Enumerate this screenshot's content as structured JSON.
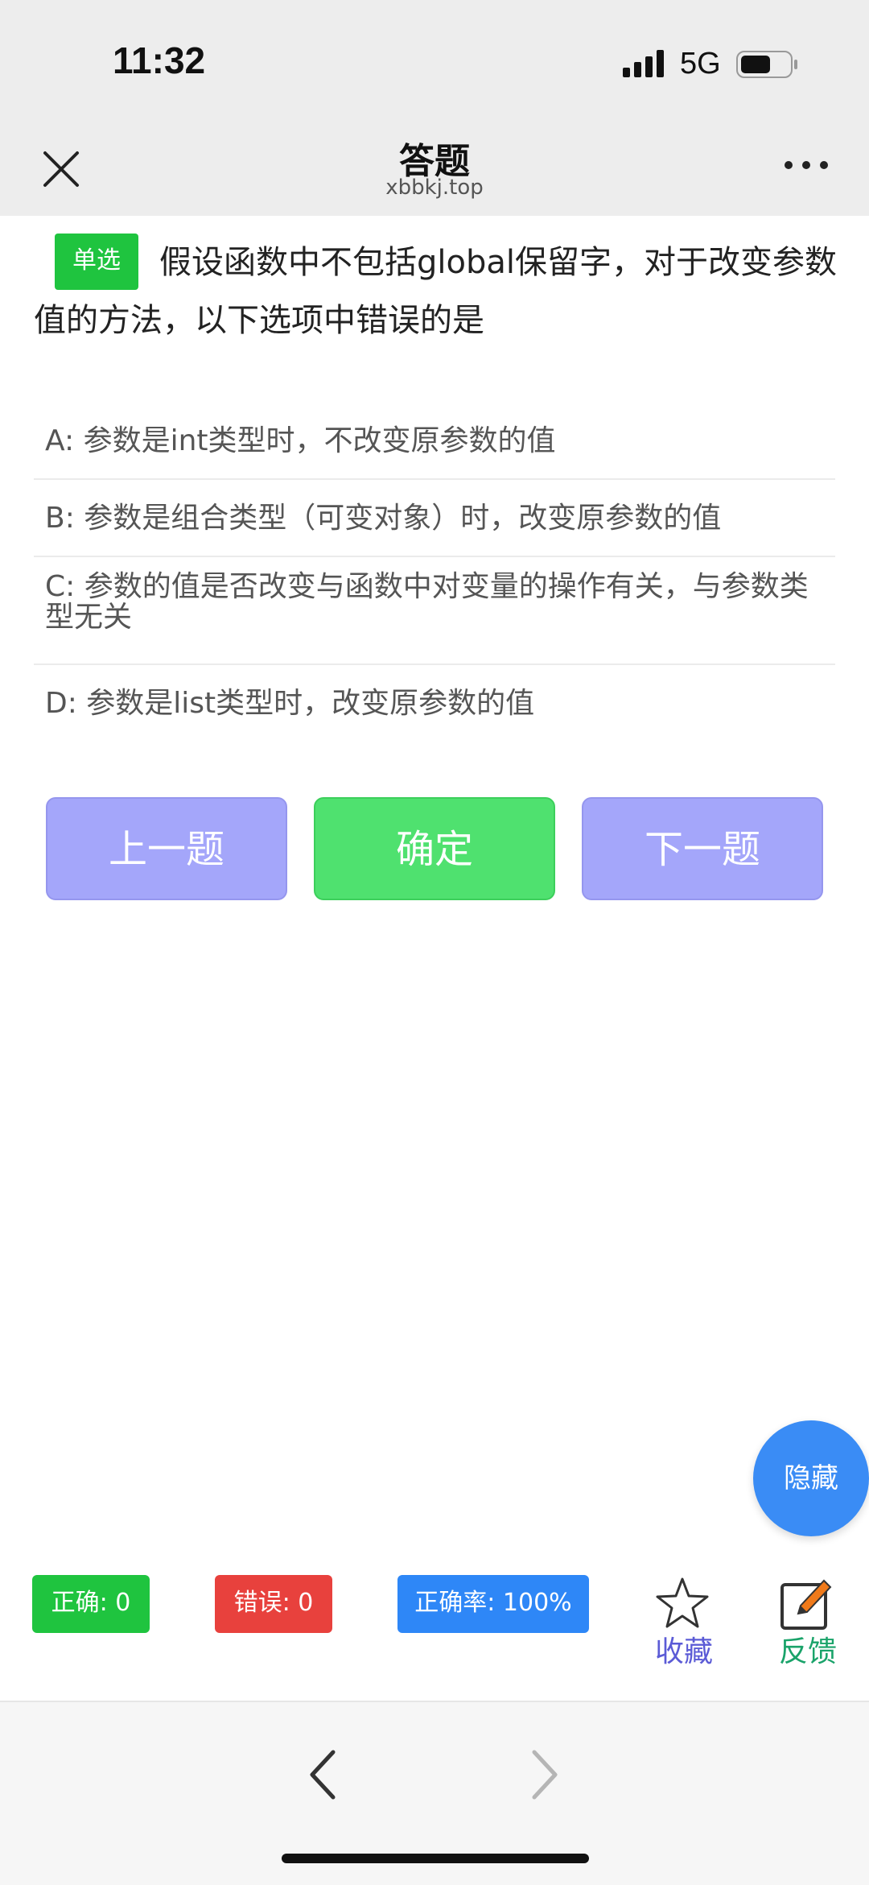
{
  "status_bar": {
    "time": "11:32",
    "network": "5G"
  },
  "header": {
    "title": "答题",
    "domain": "xbbkj.top"
  },
  "question": {
    "type_badge": "单选",
    "text": "假设函数中不包括global保留字，对于改变参数值的方法，以下选项中错误的是",
    "options": [
      {
        "label": "A: 参数是int类型时，不改变原参数的值"
      },
      {
        "label": "B: 参数是组合类型（可变对象）时，改变原参数的值"
      },
      {
        "label": "C: 参数的值是否改变与函数中对变量的操作有关，与参数类型无关"
      },
      {
        "label": "D: 参数是list类型时，改变原参数的值"
      }
    ]
  },
  "actions": {
    "prev": "上一题",
    "confirm": "确定",
    "next": "下一题"
  },
  "floating": {
    "hide": "隐藏"
  },
  "stats": {
    "correct": "正确: 0",
    "wrong": "错误: 0",
    "rate": "正确率: 100%"
  },
  "toolbar": {
    "favorite": "收藏",
    "feedback": "反馈"
  },
  "icons": {
    "close": "close-icon",
    "more": "more-icon",
    "star": "star-icon",
    "edit": "edit-icon",
    "back": "chevron-left-icon",
    "forward": "chevron-right-icon"
  },
  "colors": {
    "badge_green": "#1fc43f",
    "confirm_green": "#4fe16f",
    "nav_button": "#a4a6fa",
    "wrong_red": "#e8413d",
    "rate_blue": "#2e87f7",
    "hide_blue": "#3a8cf5"
  }
}
